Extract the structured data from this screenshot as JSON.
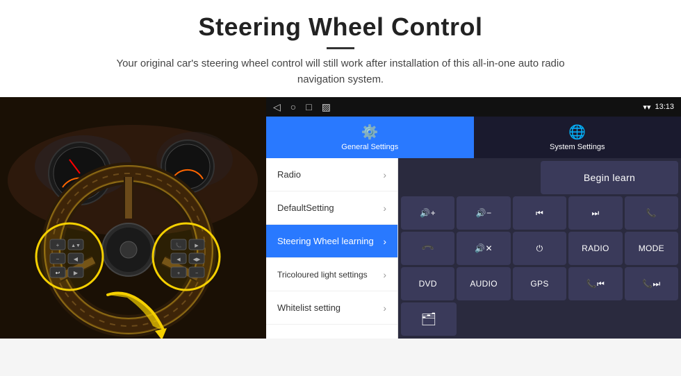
{
  "header": {
    "title": "Steering Wheel Control",
    "subtitle": "Your original car's steering wheel control will still work after installation of this all-in-one auto radio navigation system."
  },
  "status_bar": {
    "nav_back": "◁",
    "nav_home": "○",
    "nav_recent": "□",
    "nav_extra": "▨",
    "time": "13:13",
    "signal_icon": "▾",
    "wifi_icon": "▾"
  },
  "tabs": [
    {
      "id": "general",
      "label": "General Settings",
      "icon": "⚙",
      "active": true
    },
    {
      "id": "system",
      "label": "System Settings",
      "icon": "⚙",
      "active": false
    }
  ],
  "nav_items": [
    {
      "id": "radio",
      "label": "Radio",
      "active": false
    },
    {
      "id": "default",
      "label": "DefaultSetting",
      "active": false
    },
    {
      "id": "steering",
      "label": "Steering Wheel learning",
      "active": true
    },
    {
      "id": "tricoloured",
      "label": "Tricoloured light settings",
      "active": false
    },
    {
      "id": "whitelist",
      "label": "Whitelist setting",
      "active": false
    }
  ],
  "begin_learn_label": "Begin learn",
  "grid_rows": [
    [
      {
        "id": "vol_up",
        "label": "🔊+",
        "type": "icon"
      },
      {
        "id": "vol_down",
        "label": "🔊−",
        "type": "icon"
      },
      {
        "id": "prev_track",
        "label": "⏮",
        "type": "icon"
      },
      {
        "id": "next_track",
        "label": "⏭",
        "type": "icon"
      },
      {
        "id": "phone",
        "label": "📞",
        "type": "icon"
      }
    ],
    [
      {
        "id": "hang_up",
        "label": "↩",
        "type": "icon"
      },
      {
        "id": "mute",
        "label": "🔊✕",
        "type": "icon"
      },
      {
        "id": "power",
        "label": "⏻",
        "type": "icon"
      },
      {
        "id": "radio_btn",
        "label": "RADIO",
        "type": "text"
      },
      {
        "id": "mode_btn",
        "label": "MODE",
        "type": "text"
      }
    ],
    [
      {
        "id": "dvd_btn",
        "label": "DVD",
        "type": "text"
      },
      {
        "id": "audio_btn",
        "label": "AUDIO",
        "type": "text"
      },
      {
        "id": "gps_btn",
        "label": "GPS",
        "type": "text"
      },
      {
        "id": "prev_list",
        "label": "📞⏮",
        "type": "icon"
      },
      {
        "id": "next_list",
        "label": "📞⏭",
        "type": "icon"
      }
    ],
    [
      {
        "id": "file_btn",
        "label": "🗂",
        "type": "icon"
      }
    ]
  ]
}
